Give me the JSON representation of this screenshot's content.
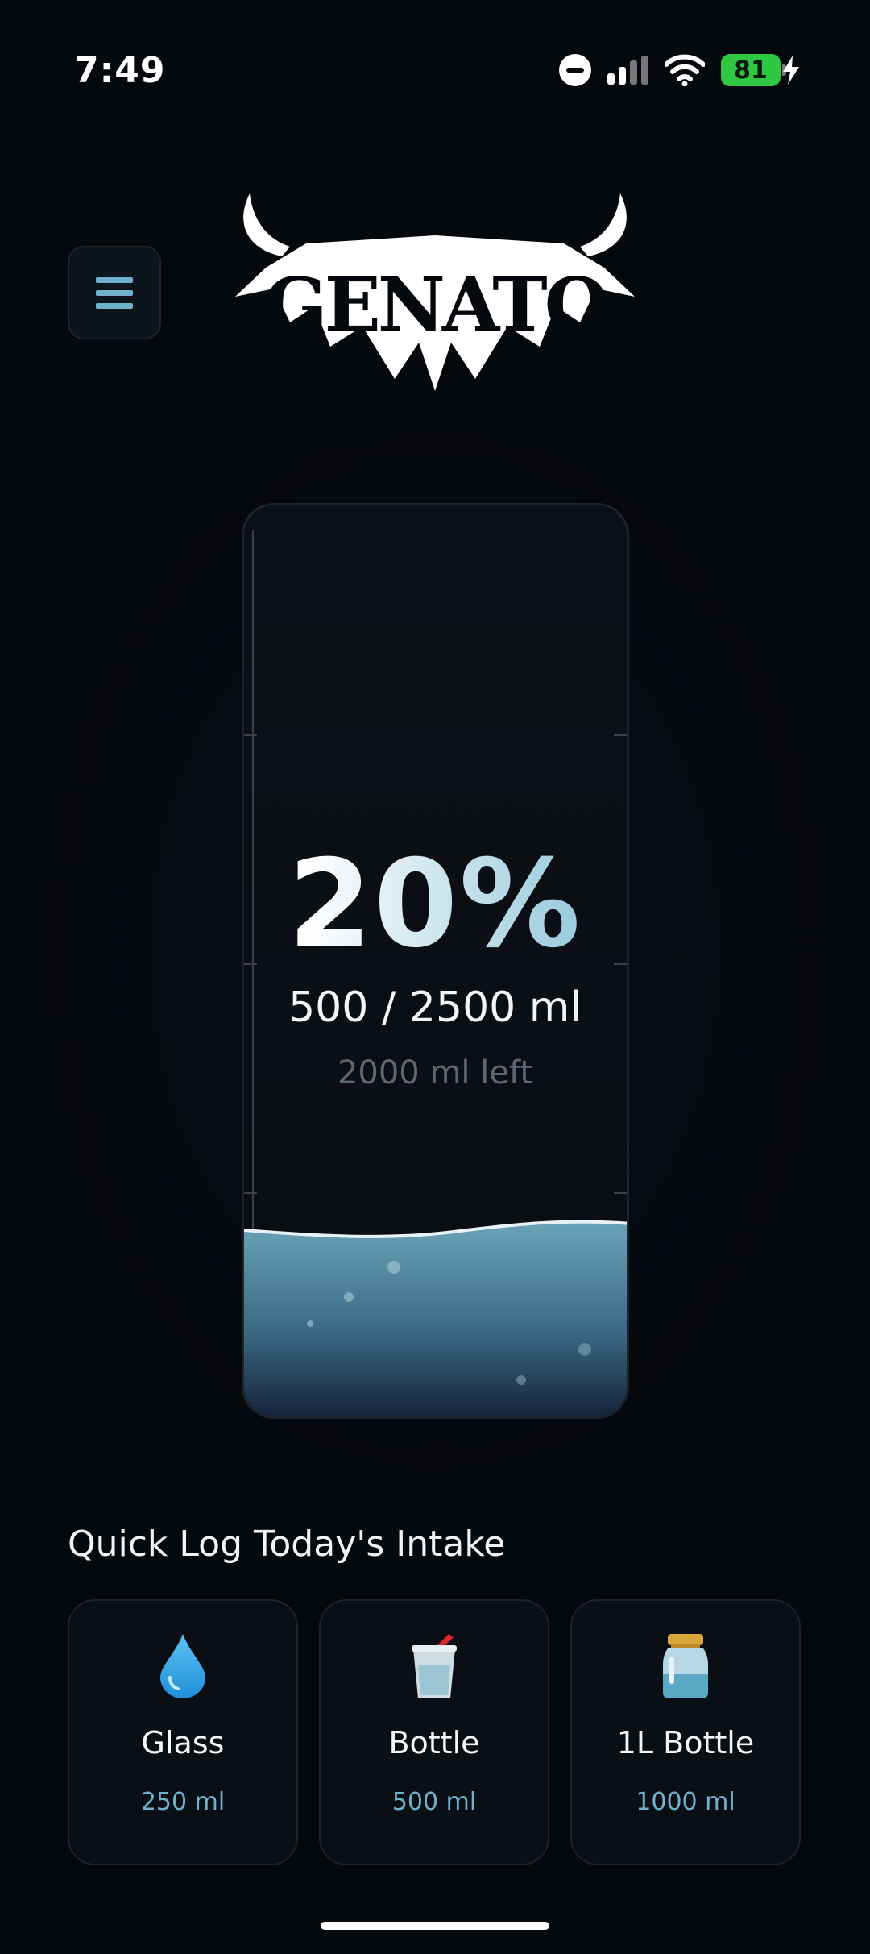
{
  "status_bar": {
    "time": "7:49",
    "battery_level": "81",
    "icons": [
      "do-not-disturb-icon",
      "cellular-signal-icon",
      "wifi-icon",
      "battery-charging-icon"
    ]
  },
  "header": {
    "menu_icon": "menu-icon",
    "logo_text": "GENATO"
  },
  "tank": {
    "percent_label": "20%",
    "fill_fraction": 0.2,
    "amount_label": "500 / 2500 ml",
    "remaining_label": "2000 ml left"
  },
  "quick_log": {
    "title": "Quick Log Today's Intake",
    "options": [
      {
        "name": "Glass",
        "volume": "250 ml",
        "icon": "water-drop-icon"
      },
      {
        "name": "Bottle",
        "volume": "500 ml",
        "icon": "cup-with-straw-icon"
      },
      {
        "name": "1L Bottle",
        "volume": "1000 ml",
        "icon": "jar-icon"
      }
    ]
  },
  "colors": {
    "background": "#05080d",
    "accent": "#6fb0cb",
    "battery_green": "#2ec843",
    "water_top": "#5e97ad",
    "water_bottom": "#14253a"
  }
}
